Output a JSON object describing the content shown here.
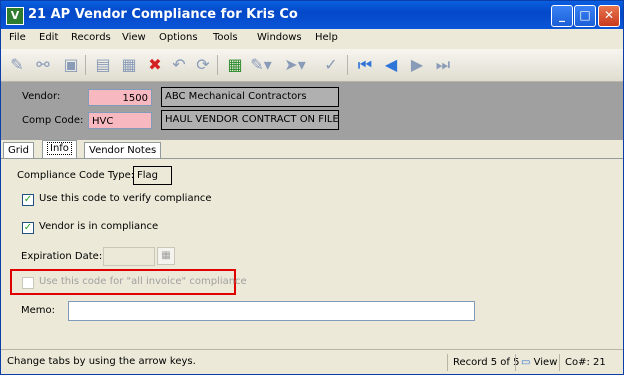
{
  "window": {
    "title": "21 AP Vendor Compliance for Kris Co",
    "icon": "app-logo-icon",
    "controls": [
      "minimize-icon",
      "maximize-icon",
      "close-icon"
    ]
  },
  "menu": [
    "File",
    "Edit",
    "Records",
    "View",
    "Options",
    "Tools",
    "Windows",
    "Help"
  ],
  "toolbar": {
    "icons": [
      "new-record-icon",
      "find-icon",
      "open-icon",
      "page-icon",
      "save-icon",
      "delete-icon",
      "undo-icon",
      "refresh-icon",
      "calculator-icon",
      "attach-icon",
      "route-icon",
      "spell-check-icon",
      "first-record-icon",
      "previous-record-icon",
      "next-record-icon",
      "last-record-icon"
    ]
  },
  "header": {
    "vendor_label": "Vendor:",
    "vendor_value": "1500",
    "vendor_name": "ABC Mechanical Contractors",
    "comp_code_label": "Comp Code:",
    "comp_code_value": "HVC",
    "comp_code_desc": "HAUL VENDOR CONTRACT ON FILE"
  },
  "tabs": [
    "Grid",
    "Info",
    "Vendor Notes"
  ],
  "info": {
    "compliance_code_type_label": "Compliance Code Type:",
    "compliance_code_type_value": "Flag",
    "verify_label": "Use this code to verify compliance",
    "verify_checked": true,
    "in_compliance_label": "Vendor is in compliance",
    "in_compliance_checked": true,
    "expiration_label": "Expiration Date:",
    "expiration_value": "",
    "all_invoice_label": "Use this code for \"all invoice\" compliance",
    "all_invoice_checked": false,
    "memo_label": "Memo:",
    "memo_value": ""
  },
  "status": {
    "hint": "Change tabs by using the arrow keys.",
    "record": "Record 5 of 5",
    "view": "View",
    "company": "Co#: 21"
  },
  "colors": {
    "titlebar": "#0348c8",
    "required_field": "#f7b8c0",
    "highlight_box": "#e00000",
    "header_panel": "#a0a0a0"
  }
}
